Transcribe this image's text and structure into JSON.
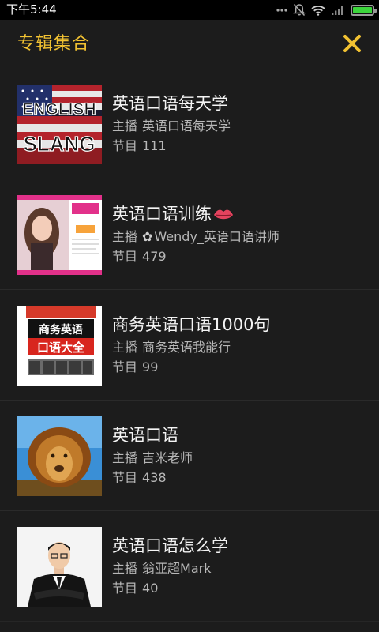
{
  "status_bar": {
    "time": "下午5:44",
    "icons": [
      "signal-dots-icon",
      "mute-bell-icon",
      "wifi-icon",
      "cell-signal-icon",
      "battery-icon"
    ],
    "battery_level": 1.0,
    "battery_color": "#3cd53c"
  },
  "header": {
    "title": "专辑集合",
    "close_icon": "close-icon",
    "accent_color": "#f2c232"
  },
  "labels": {
    "host_prefix": "主播",
    "count_prefix": "节目"
  },
  "albums": [
    {
      "title": "英语口语每天学",
      "host": "英语口语每天学",
      "count": "111",
      "cover": "english-slang-flag-cover"
    },
    {
      "title": "英语口语训练",
      "title_emoji": "lips-icon",
      "host": "Wendy_英语口语讲师",
      "host_flower": "✿",
      "count": "479",
      "cover": "girl-portrait-cover"
    },
    {
      "title": "商务英语口语1000句",
      "host": "商务英语我能行",
      "count": "99",
      "cover": "business-english-book-cover"
    },
    {
      "title": "英语口语",
      "host": "吉米老师",
      "count": "438",
      "cover": "lion-cover"
    },
    {
      "title": "英语口语怎么学",
      "host": "翁亚超Mark",
      "count": "40",
      "cover": "man-in-suit-cover"
    }
  ]
}
